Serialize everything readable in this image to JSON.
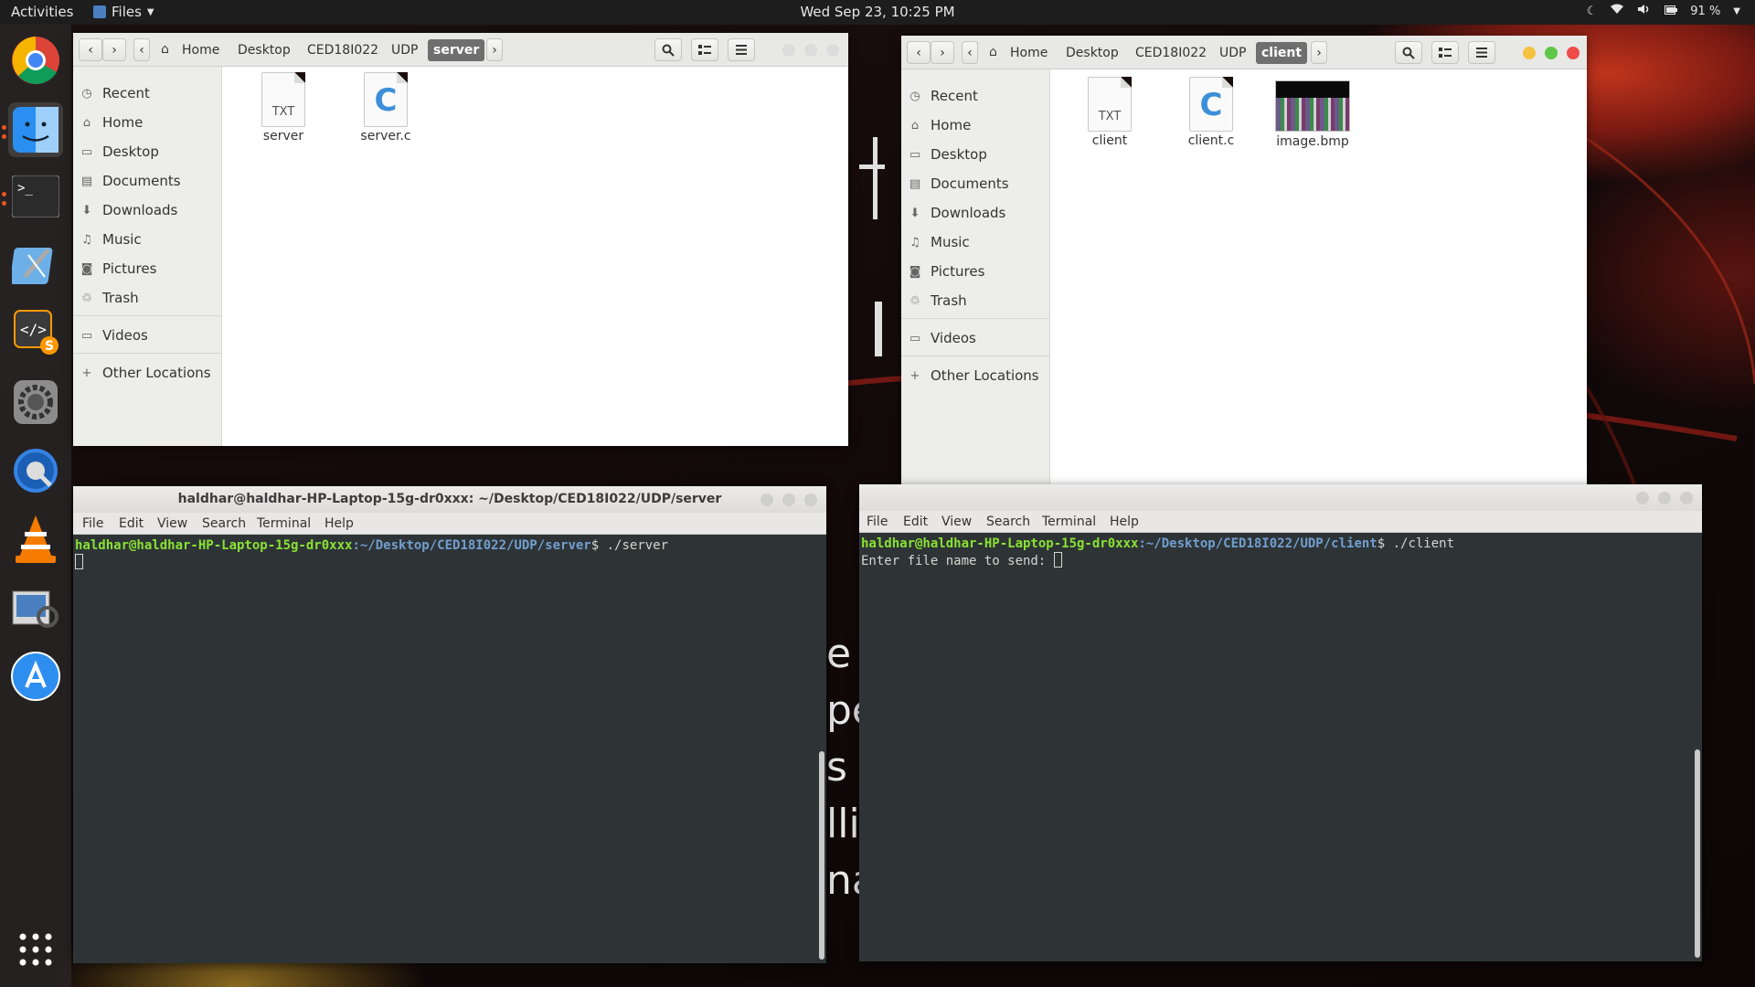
{
  "topbar": {
    "activities": "Activities",
    "app_menu": "Files",
    "clock": "Wed Sep 23, 10:25 PM",
    "battery": "91 %"
  },
  "dock": {
    "items": [
      "chrome-icon",
      "finder-icon",
      "terminal-icon",
      "xcode-icon",
      "sublime-icon",
      "settings-icon",
      "quicktime-icon",
      "vlc-icon",
      "preview-icon",
      "app-store-icon",
      "show-apps-icon"
    ]
  },
  "fm_left": {
    "breadcrumbs": [
      "Home",
      "Desktop",
      "CED18I022",
      "UDP",
      "server"
    ],
    "sidebar": [
      "Recent",
      "Home",
      "Desktop",
      "Documents",
      "Downloads",
      "Music",
      "Pictures",
      "Trash",
      "Videos",
      "Other Locations"
    ],
    "files": [
      {
        "name": "server",
        "type": "TXT"
      },
      {
        "name": "server.c",
        "type": "C"
      }
    ]
  },
  "fm_right": {
    "breadcrumbs": [
      "Home",
      "Desktop",
      "CED18I022",
      "UDP",
      "client"
    ],
    "sidebar": [
      "Recent",
      "Home",
      "Desktop",
      "Documents",
      "Downloads",
      "Music",
      "Pictures",
      "Trash",
      "Videos",
      "Other Locations"
    ],
    "files": [
      {
        "name": "client",
        "type": "TXT"
      },
      {
        "name": "client.c",
        "type": "C"
      },
      {
        "name": "image.bmp",
        "type": "image"
      }
    ]
  },
  "term_left": {
    "title": "haldhar@haldhar-HP-Laptop-15g-dr0xxx: ~/Desktop/CED18I022/UDP/server",
    "menu": [
      "File",
      "Edit",
      "View",
      "Search",
      "Terminal",
      "Help"
    ],
    "prompt_user": "haldhar@haldhar-HP-Laptop-15g-dr0xxx",
    "prompt_path": ":~/Desktop/CED18I022/UDP/server",
    "command": "$ ./server"
  },
  "term_right": {
    "menu": [
      "File",
      "Edit",
      "View",
      "Search",
      "Terminal",
      "Help"
    ],
    "prompt_user": "haldhar@haldhar-HP-Laptop-15g-dr0xxx",
    "prompt_path": ":~/Desktop/CED18I022/UDP/client",
    "command": "$ ./client",
    "output": "Enter file name to send: "
  },
  "wallpaper_text": [
    "e",
    "pe",
    "s",
    "lli",
    "na"
  ],
  "colors": {
    "accent": "#e95420",
    "term_bg": "#2e3436",
    "prompt_user": "#8ae234",
    "prompt_path": "#729fcf"
  }
}
